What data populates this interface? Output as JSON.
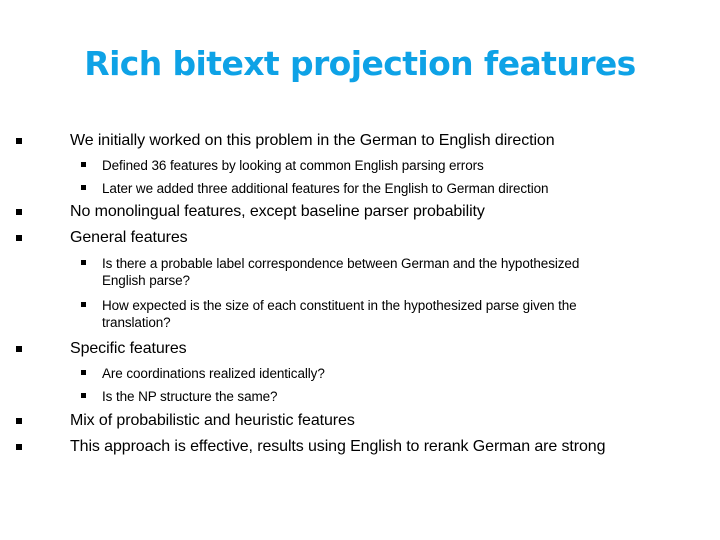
{
  "slide": {
    "title": "Rich bitext projection features",
    "title_color": "#0ea2e6",
    "bullets": [
      {
        "text": "We initially worked on this problem in the German to English direction",
        "sub": [
          "Defined 36 features by looking at common English parsing errors",
          "Later we added three additional features for the English to German direction"
        ]
      },
      {
        "text": "No monolingual features, except baseline parser probability",
        "sub": []
      },
      {
        "text": "General features",
        "sub": [
          [
            "Is there a probable label correspondence between German and the hypothesized",
            "English parse?"
          ],
          [
            "How expected is the size of each constituent in the hypothesized parse given the",
            "translation?"
          ]
        ]
      },
      {
        "text": "Specific features",
        "sub": [
          "Are coordinations realized identically?",
          "Is the NP structure the same?"
        ]
      },
      {
        "text": "Mix of probabilistic and heuristic features",
        "sub": []
      },
      {
        "text": "This approach is effective, results using English to rerank German are strong",
        "sub": []
      }
    ]
  }
}
